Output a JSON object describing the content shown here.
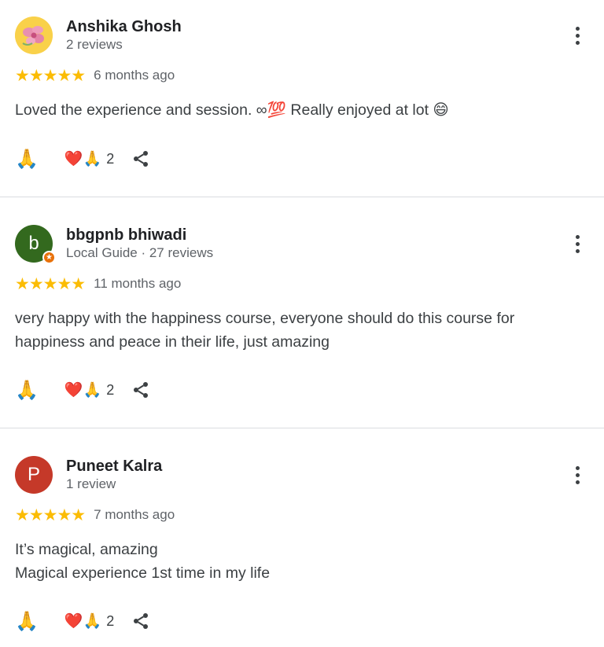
{
  "reviews": [
    {
      "name": "Anshika Ghosh",
      "meta": "2 reviews",
      "stars": "★★★★★",
      "time": "6 months ago",
      "text_lines": [
        "Loved the experience and session. ∞💯 Really enjoyed at lot 😄"
      ],
      "reactions": {
        "pray_icon": "🙏",
        "heart_pray_icon": "❤️🙏",
        "count": "2"
      },
      "avatar": {
        "type": "image",
        "description": "flower-avatar"
      }
    },
    {
      "name": "bbgpnb bhiwadi",
      "meta": "Local Guide · 27 reviews",
      "stars": "★★★★★",
      "time": "11 months ago",
      "text_lines": [
        "very happy with the happiness course, everyone should do this course for",
        "happiness and peace in their life, just amazing"
      ],
      "reactions": {
        "pray_icon": "🙏",
        "heart_pray_icon": "❤️🙏",
        "count": "2"
      },
      "avatar": {
        "type": "letter",
        "letter": "b",
        "color": "#33691e"
      }
    },
    {
      "name": "Puneet Kalra",
      "meta": "1 review",
      "stars": "★★★★★",
      "time": "7 months ago",
      "text_lines": [
        "It’s magical, amazing",
        "Magical experience 1st time in my life"
      ],
      "reactions": {
        "pray_icon": "🙏",
        "heart_pray_icon": "❤️🙏",
        "count": "2"
      },
      "avatar": {
        "type": "letter",
        "letter": "P",
        "color": "#c53929"
      }
    }
  ],
  "colors": {
    "star": "#fbbc04",
    "meta_text": "#5f6368",
    "body_text": "#3c4043",
    "divider": "#dadce0",
    "guide_badge": "#e8710a"
  },
  "icons": {
    "more": "more-vert-icon",
    "share": "share-icon",
    "guide_badge": "local-guide-star-icon"
  }
}
